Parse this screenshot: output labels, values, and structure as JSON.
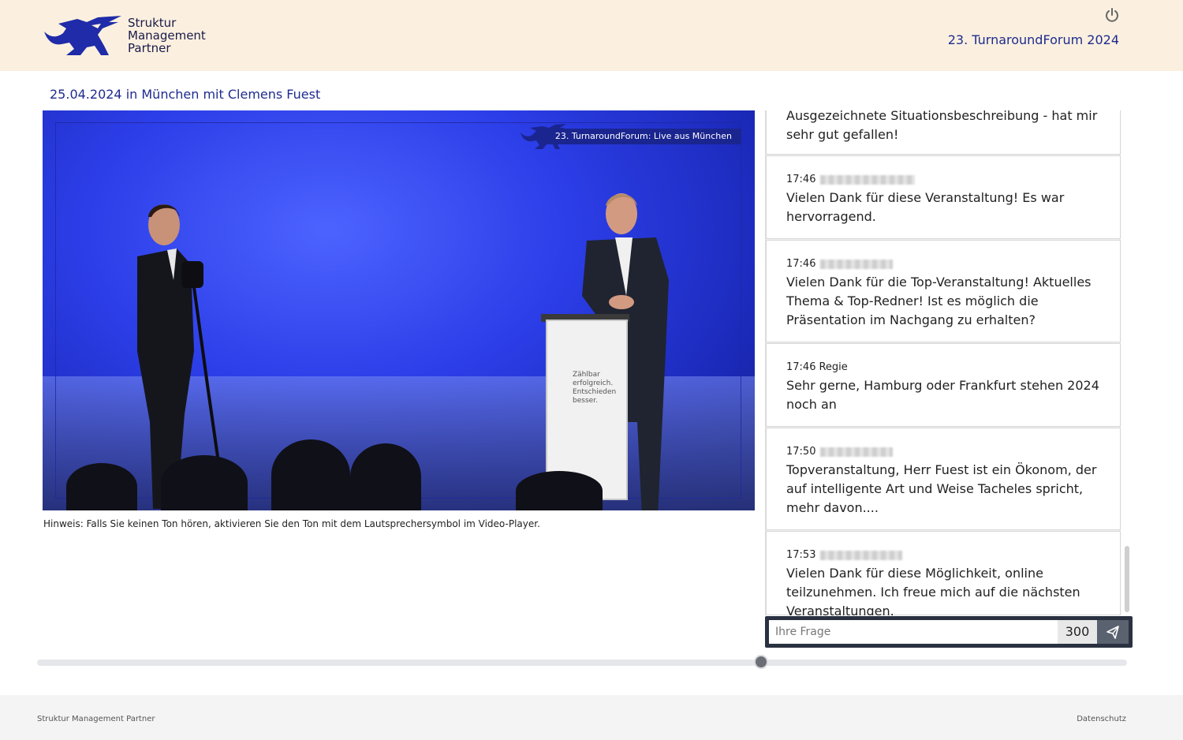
{
  "header": {
    "logo_lines": [
      "Struktur",
      "Management",
      "Partner"
    ],
    "event_title": "23. TurnaroundForum 2024"
  },
  "session": {
    "subtitle": "25.04.2024 in München mit Clemens Fuest"
  },
  "video": {
    "overlay_label": "23. TurnaroundForum: Live aus München",
    "podium_lines": [
      "Zählbar",
      "erfolgreich.",
      "Entschieden",
      "besser."
    ],
    "hint": "Hinweis: Falls Sie keinen Ton hören, aktivieren Sie den Ton mit dem Lautsprechersymbol im Video-Player."
  },
  "chat": {
    "messages": [
      {
        "time": "",
        "author": "",
        "text": "Ausgezeichnete Situationsbeschreibung - hat mir sehr gut gefallen!"
      },
      {
        "time": "17:46",
        "author": "",
        "text": "Vielen Dank für diese Veranstaltung! Es war hervorragend."
      },
      {
        "time": "17:46",
        "author": "",
        "text": "Vielen Dank für die Top-Veranstaltung! Aktuelles Thema & Top-Redner! Ist es möglich die Präsentation  im Nachgang zu erhalten?"
      },
      {
        "time": "17:46",
        "author": "Regie",
        "text": "Sehr gerne, Hamburg oder Frankfurt stehen 2024 noch an"
      },
      {
        "time": "17:50",
        "author": "",
        "text": "Topveranstaltung, Herr Fuest ist ein Ökonom, der auf intelligente Art und Weise Tacheles spricht, mehr davon...."
      },
      {
        "time": "17:53",
        "author": "",
        "text": "Vielen Dank für diese Möglichkeit, online teilzunehmen. Ich freue mich auf die nächsten Veranstaltungen."
      }
    ],
    "input_placeholder": "Ihre Frage",
    "char_counter": "300",
    "send_icon": "send-icon"
  },
  "playback": {
    "progress": 0.664
  },
  "footer": {
    "left": "Struktur Management Partner",
    "right": "Datenschutz"
  },
  "colors": {
    "header_bg": "#fbf0df",
    "accent": "#1f2b8f",
    "footer_bg": "#f4f4f4"
  }
}
